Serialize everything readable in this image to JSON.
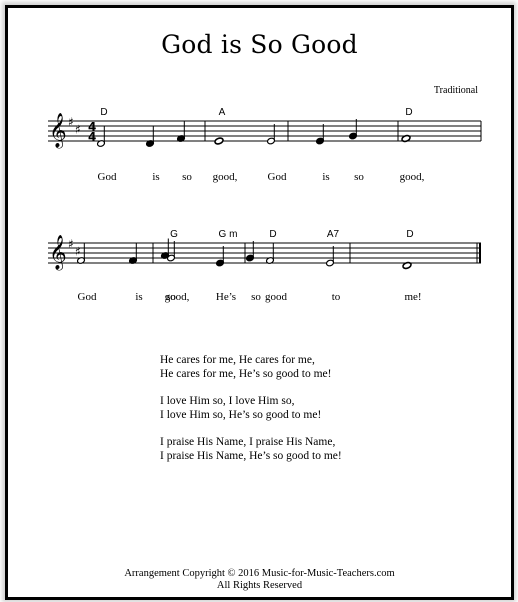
{
  "title": "God is So Good",
  "composer": "Traditional",
  "key_signature": "D major",
  "time_signature": "4/4",
  "staves": [
    {
      "chords": [
        {
          "label": "D",
          "beat_ref": "m1b1"
        },
        {
          "label": "A",
          "beat_ref": "m2b1"
        },
        {
          "label": "D",
          "beat_ref": "m4b1"
        }
      ],
      "measures": [
        [
          {
            "pitch": "D4",
            "dur": "half"
          },
          {
            "pitch": "D4",
            "dur": "quarter"
          },
          {
            "pitch": "F#4",
            "dur": "quarter"
          }
        ],
        [
          {
            "pitch": "E4",
            "dur": "whole"
          }
        ],
        [
          {
            "pitch": "E4",
            "dur": "half"
          },
          {
            "pitch": "E4",
            "dur": "quarter"
          },
          {
            "pitch": "G4",
            "dur": "quarter"
          }
        ],
        [
          {
            "pitch": "F#4",
            "dur": "whole"
          }
        ]
      ],
      "lyrics": [
        "God",
        "is",
        "so",
        "good,",
        "God",
        "is",
        "so",
        "good,"
      ],
      "show_time_sig": true,
      "final": false
    },
    {
      "chords": [
        {
          "label": "G"
        },
        {
          "label": "G m"
        },
        {
          "label": "D"
        },
        {
          "label": "A7"
        },
        {
          "label": "D"
        }
      ],
      "measures": [
        [
          {
            "pitch": "F#4",
            "dur": "half"
          },
          {
            "pitch": "F#4",
            "dur": "quarter"
          },
          {
            "pitch": "A4",
            "dur": "quarter"
          }
        ],
        [
          {
            "pitch": "G4",
            "dur": "half"
          },
          {
            "pitch": "E4",
            "dur": "quarter"
          },
          {
            "pitch": "G4",
            "dur": "quarter"
          }
        ],
        [
          {
            "pitch": "F#4",
            "dur": "half"
          },
          {
            "pitch": "E4",
            "dur": "half"
          }
        ],
        [
          {
            "pitch": "D4",
            "dur": "whole"
          }
        ]
      ],
      "lyrics": [
        "God",
        "is",
        "so",
        "good,",
        "He’s",
        "so",
        "good",
        "to",
        "me!"
      ],
      "show_time_sig": false,
      "final": true
    }
  ],
  "verses": [
    [
      "He cares for me, He cares for me,",
      "He cares for me, He’s so good to me!"
    ],
    [
      "I love Him so, I love Him so,",
      "I love Him so, He’s so good to me!"
    ],
    [
      "I praise His Name, I praise His Name,",
      "I praise His Name, He’s so good to me!"
    ]
  ],
  "footer": {
    "copyright": "Arrangement Copyright  © 2016 Music-for-Music-Teachers.com",
    "rights": "All Rights Reserved"
  }
}
